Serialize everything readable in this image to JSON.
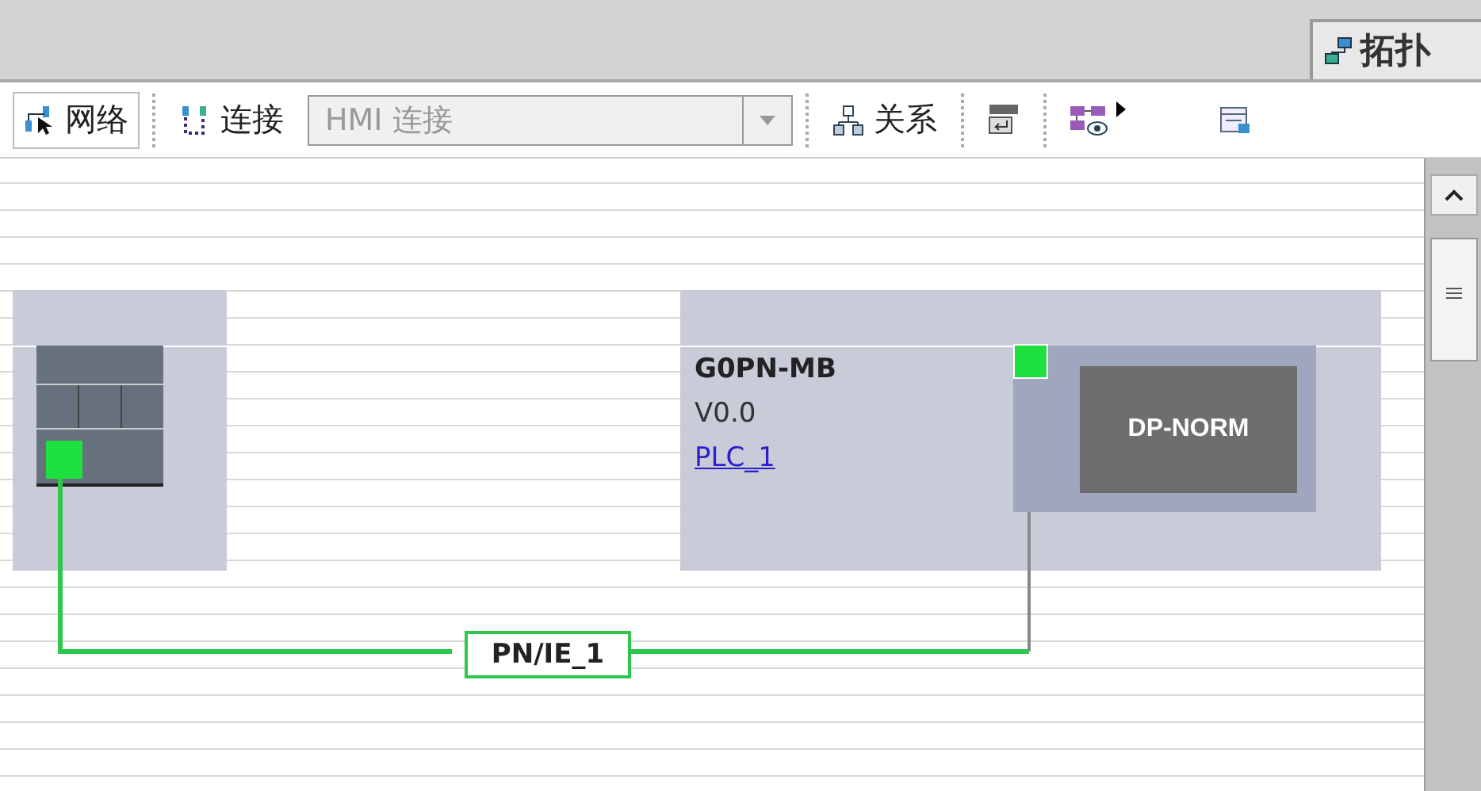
{
  "view_tab": {
    "label": "拓扑"
  },
  "toolbar": {
    "network_button": {
      "label": "网络",
      "selected": true
    },
    "connections_button": {
      "label": "连接",
      "selected": false
    },
    "connection_type": {
      "value": "HMI 连接",
      "disabled": true
    },
    "relations_button": {
      "label": "关系"
    }
  },
  "devices": [
    {
      "kind": "plc"
    },
    {
      "kind": "module",
      "name": "G0PN-MB",
      "version": "V0.0",
      "link": "PLC_1",
      "module_label": "DP-NORM"
    }
  ],
  "network": {
    "label": "PN/IE_1"
  }
}
